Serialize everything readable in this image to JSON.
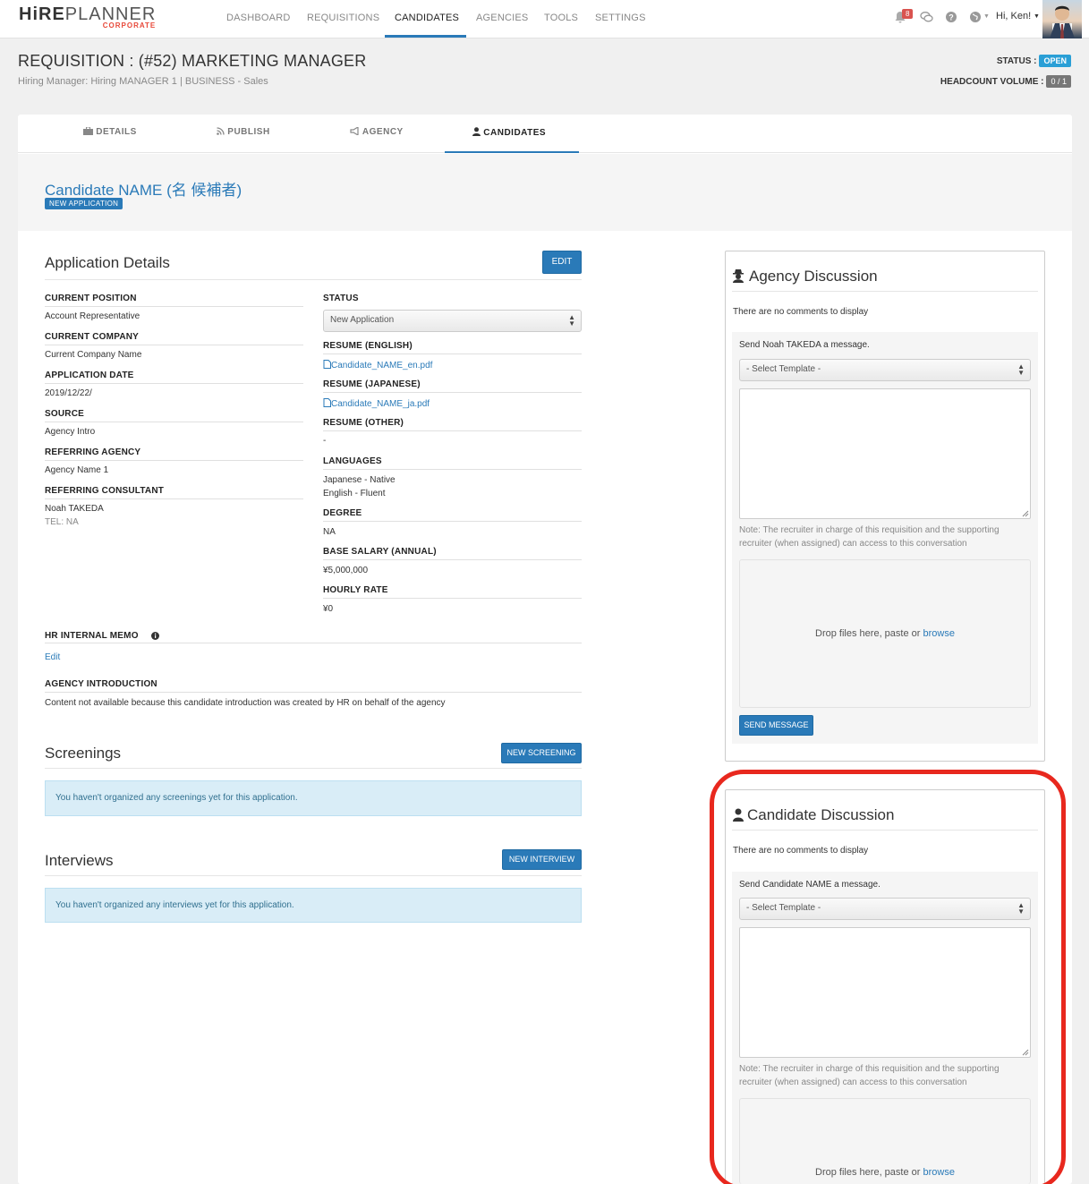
{
  "logo": {
    "hire": "HiRE",
    "planner": "PLANNER",
    "sub": "CORPORATE"
  },
  "nav": {
    "items": [
      "DASHBOARD",
      "REQUISITIONS",
      "CANDIDATES",
      "AGENCIES",
      "TOOLS",
      "SETTINGS"
    ],
    "active": "CANDIDATES",
    "notification_count": "8",
    "greeting": "Hi, Ken!"
  },
  "requisition": {
    "title": "REQUISITION : (#52) MARKETING MANAGER",
    "subtitle": "Hiring Manager: Hiring MANAGER 1 | BUSINESS - Sales",
    "status_label": "STATUS :",
    "status_value": "OPEN",
    "headcount_label": "HEADCOUNT VOLUME :",
    "headcount_value": "0 / 1"
  },
  "tabs": [
    {
      "label": "DETAILS",
      "icon": "briefcase-icon"
    },
    {
      "label": "PUBLISH",
      "icon": "rss-icon"
    },
    {
      "label": "AGENCY",
      "icon": "bullhorn-icon"
    },
    {
      "label": "CANDIDATES",
      "icon": "user-icon"
    }
  ],
  "candidate": {
    "name": "Candidate NAME (名 候補者)",
    "badge": "NEW APPLICATION"
  },
  "application": {
    "title": "Application Details",
    "edit_label": "EDIT",
    "left_fields": [
      {
        "label": "CURRENT POSITION",
        "value": "Account Representative"
      },
      {
        "label": "CURRENT COMPANY",
        "value": "Current Company Name"
      },
      {
        "label": "APPLICATION DATE",
        "value": "2019/12/22/"
      },
      {
        "label": "SOURCE",
        "value": "Agency Intro"
      },
      {
        "label": "REFERRING AGENCY",
        "value": "Agency Name 1"
      },
      {
        "label": "REFERRING CONSULTANT",
        "value": "Noah TAKEDA",
        "extra": "TEL: NA"
      }
    ],
    "status_label": "STATUS",
    "status_value": "New Application",
    "resume_en_label": "RESUME (ENGLISH)",
    "resume_en_file": "Candidate_NAME_en.pdf",
    "resume_ja_label": "RESUME (JAPANESE)",
    "resume_ja_file": "Candidate_NAME_ja.pdf",
    "resume_other_label": "RESUME (OTHER)",
    "resume_other_value": "-",
    "languages_label": "LANGUAGES",
    "languages": [
      "Japanese - Native",
      "English - Fluent"
    ],
    "degree_label": "DEGREE",
    "degree_value": "NA",
    "salary_label": "BASE SALARY (ANNUAL)",
    "salary_value": "¥5,000,000",
    "hourly_label": "HOURLY RATE",
    "hourly_value": "¥0",
    "memo_label": "HR INTERNAL MEMO",
    "memo_edit": "Edit",
    "intro_label": "AGENCY INTRODUCTION",
    "intro_value": "Content not available because this candidate introduction was created by HR on behalf of the agency"
  },
  "screenings": {
    "title": "Screenings",
    "button": "NEW SCREENING",
    "empty": "You haven't organized any screenings yet for this application."
  },
  "interviews": {
    "title": "Interviews",
    "button": "NEW INTERVIEW",
    "empty": "You haven't organized any interviews yet for this application."
  },
  "agency_discussion": {
    "title": "Agency Discussion",
    "no_comments": "There are no comments to display",
    "send_to": "Send Noah TAKEDA a message.",
    "template": "- Select Template -",
    "note": "Note: The recruiter in charge of this requisition and the supporting recruiter (when assigned) can access to this conversation",
    "drop_text": "Drop files here, paste or ",
    "browse": "browse",
    "send_button": "SEND MESSAGE"
  },
  "candidate_discussion": {
    "title": "Candidate Discussion",
    "no_comments": "There are no comments to display",
    "send_to": "Send Candidate NAME a message.",
    "template": "- Select Template -",
    "note": "Note: The recruiter in charge of this requisition and the supporting recruiter (when assigned) can access to this conversation",
    "drop_text": "Drop files here, paste or ",
    "browse": "browse"
  }
}
